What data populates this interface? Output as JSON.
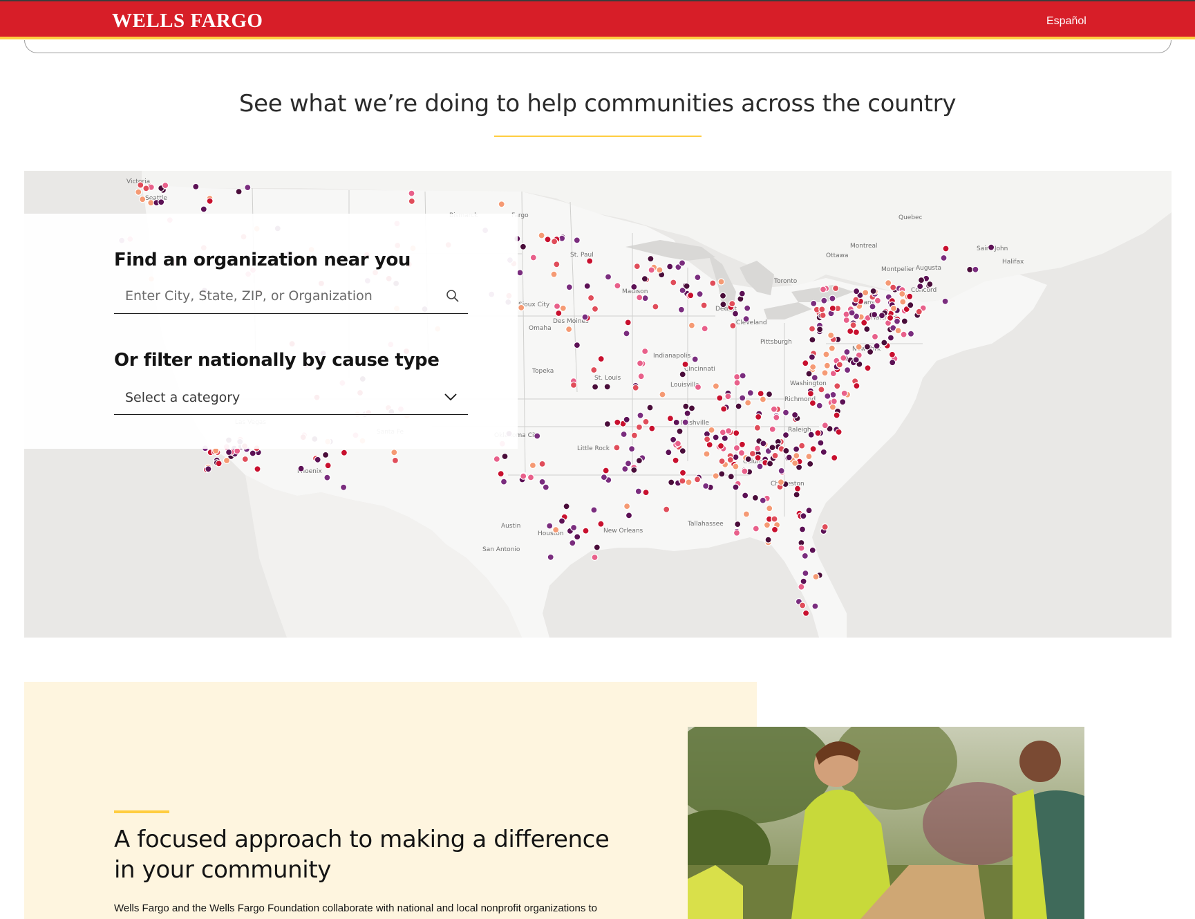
{
  "header": {
    "logo_text": "WELLS FARGO",
    "language_link": "Español",
    "brand_color": "#d71e28",
    "accent_color": "#ffcd41"
  },
  "section": {
    "title": "See what we’re doing to help communities across the country"
  },
  "map": {
    "city_labels": [
      "Victoria",
      "Seattle",
      "Fargo",
      "Bismarck",
      "St. Paul",
      "Madison",
      "Sioux City",
      "Des Moines",
      "Omaha",
      "Topeka",
      "St. Louis",
      "Indianapolis",
      "Cincinnati",
      "Louisville",
      "Nashville",
      "Oklahoma City",
      "Little Rock",
      "Santa Fe",
      "Phoenix",
      "Las Vegas",
      "Austin",
      "San Antonio",
      "Houston",
      "New Orleans",
      "Tallahassee",
      "Columbia",
      "Charleston",
      "Raleigh",
      "Richmond",
      "Washington",
      "Pittsburgh",
      "Cleveland",
      "Detroit",
      "Toronto",
      "Ottawa",
      "Montreal",
      "Quebec",
      "Montpelier",
      "Augusta",
      "Concord",
      "Hartford",
      "Albany",
      "Saint John",
      "Halifax",
      "New York"
    ],
    "marker_colors": [
      "#4a0d3a",
      "#5c1155",
      "#7a2d7e",
      "#e04d5a",
      "#f59a74",
      "#e8608a",
      "#c8102e"
    ]
  },
  "search_panel": {
    "find_heading": "Find an organization near you",
    "search_placeholder": "Enter City, State, ZIP, or Organization",
    "filter_heading": "Or filter nationally by cause type",
    "category_select": "Select a category"
  },
  "promo": {
    "title": "A focused approach to making a difference in your community",
    "body": "Wells Fargo and the Wells Fargo Foundation collaborate with national and local nonprofit organizations to support economic opportunities, small businesses, affordable housing, and environmental justice."
  }
}
